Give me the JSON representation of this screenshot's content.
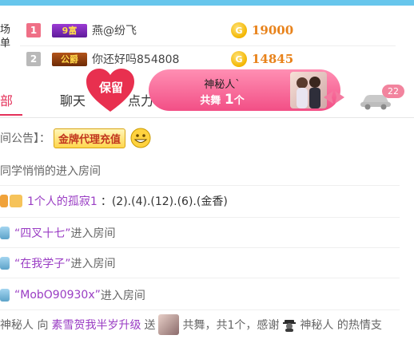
{
  "leaderboard": {
    "left_text": [
      "场",
      "单"
    ],
    "rows": [
      {
        "rank": "1",
        "badge": "9富",
        "name": "燕@纷飞",
        "coin": "G",
        "score": "19000"
      },
      {
        "rank": "2",
        "badge": "公爵",
        "name": "你还好吗854808",
        "coin": "G",
        "score": "14845"
      }
    ]
  },
  "tabs": {
    "partial_first": "部",
    "chat": "聊天",
    "partial_third": "点力"
  },
  "heart_label": "保留",
  "banner": {
    "line1": "神秘人`",
    "line2_prefix": "共舞",
    "line2_count": "1",
    "line2_suffix": "个"
  },
  "car_badge": "22",
  "chat": {
    "announce_label": "间公告】：",
    "announce_button": "金牌代理充值",
    "m1": "同学悄悄的进入房间",
    "m2_user": "1个人的孤寂1",
    "m2_text": "：(2).(4).(12).(6).(金香)",
    "m3_user": "“四叉十七”",
    "m3_text": "进入房间",
    "m4_user": "“在我学子”",
    "m4_text": "进入房间",
    "m5_user": "“MobO90930x”",
    "m5_text": "进入房间",
    "m6_a": "神秘人 向",
    "m6_user": "素雪贺我半岁升级",
    "m6_b": "送",
    "m6_c": "共舞，共1个，感谢",
    "m6_d": "神秘人 的热情支"
  },
  "colors": {
    "accent": "#e4315a",
    "topbar": "#67c6ec",
    "score": "#e8821a",
    "link": "#9a3dc4"
  },
  "icons": [
    "coin-icon",
    "heart-icon",
    "car-icon",
    "smiley-icon",
    "vip-icon",
    "user-icon",
    "phone-icon",
    "spy-icon"
  ]
}
